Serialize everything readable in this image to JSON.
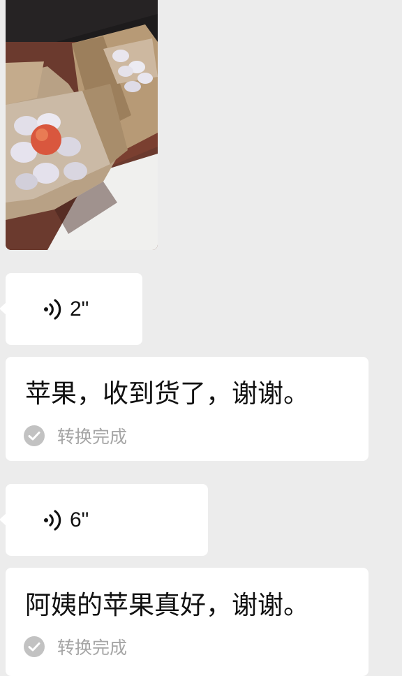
{
  "messages": [
    {
      "type": "image",
      "icon": "photo-apples-in-boxes"
    },
    {
      "type": "voice",
      "duration": "2\"",
      "icon": "voice-wave-icon"
    },
    {
      "type": "transcript",
      "text": "苹果，收到货了，谢谢。",
      "status": "转换完成",
      "status_icon": "check-circle-icon"
    },
    {
      "type": "voice",
      "duration": "6\"",
      "icon": "voice-wave-icon"
    },
    {
      "type": "transcript",
      "text": "阿姨的苹果真好，谢谢。",
      "status": "转换完成",
      "status_icon": "check-circle-icon"
    }
  ],
  "colors": {
    "background": "#ececec",
    "bubble": "#ffffff",
    "text": "#111111",
    "status_text": "#a5a5a5",
    "check_icon": "#c2c2c2"
  }
}
